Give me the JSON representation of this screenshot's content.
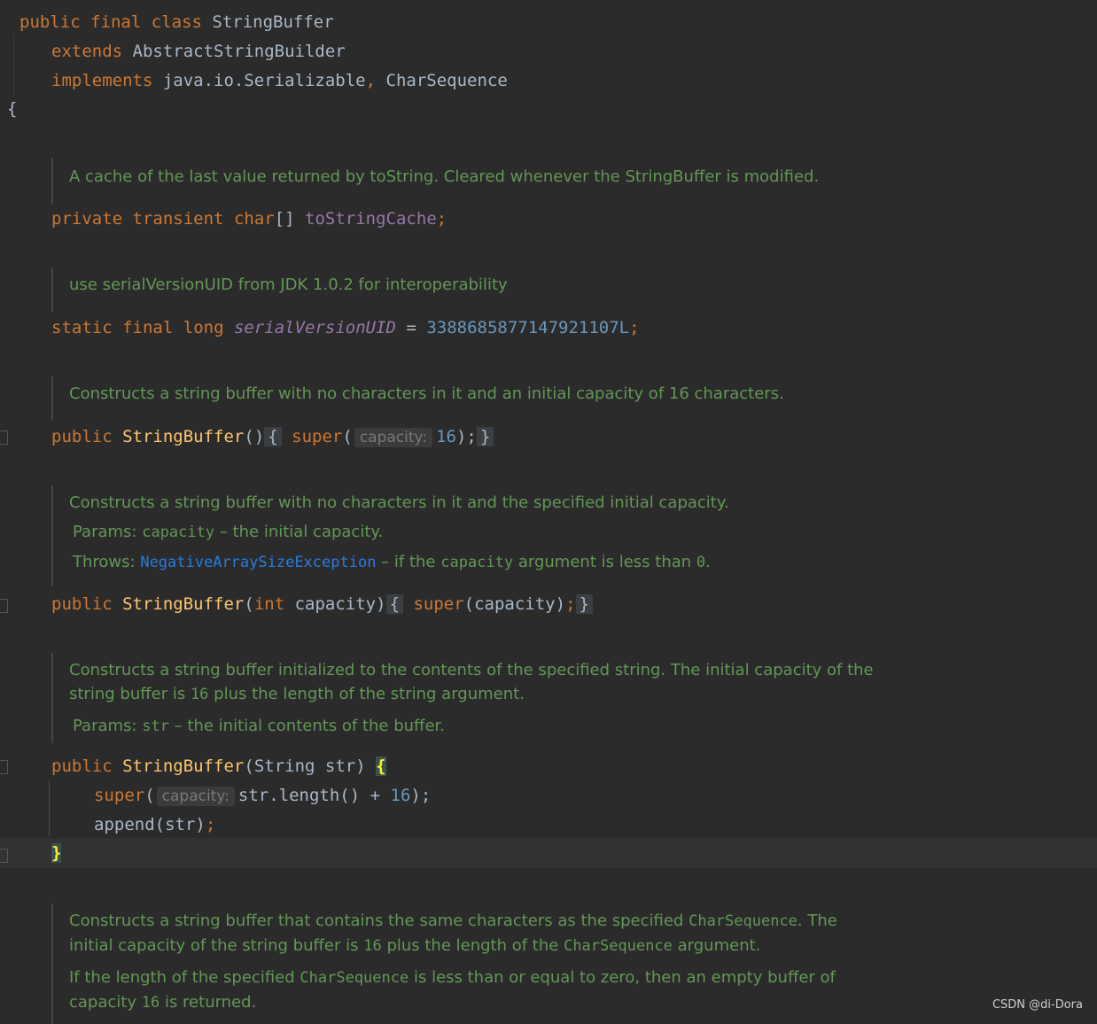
{
  "code": {
    "class_decl": {
      "public": "public",
      "final": "final",
      "class": "class",
      "name": "StringBuffer"
    },
    "extends_line": {
      "kw": "extends",
      "name": "AbstractStringBuilder"
    },
    "implements_line": {
      "kw": "implements",
      "name1": "java.io.Serializable",
      "comma": ",",
      "name2": "CharSequence"
    },
    "open_brace": "{",
    "doc1": "A cache of the last value returned by toString. Cleared whenever the StringBuffer is modified.",
    "field1": {
      "private": "private",
      "transient": "transient",
      "type": "char",
      "brackets": "[]",
      "name": "toStringCache",
      "semi": ";"
    },
    "doc2": "use serialVersionUID from JDK 1.0.2 for interoperability",
    "field2": {
      "static": "static",
      "final": "final",
      "long": "long",
      "name": "serialVersionUID",
      "eq": " = ",
      "value": "3388685877147921107L",
      "semi": ";"
    },
    "doc3": "Constructs a string buffer with no characters in it and an initial capacity of 16 characters.",
    "ctor1": {
      "public": "public",
      "name": "StringBuffer",
      "parens": "()",
      "open": "{",
      "super": "super",
      "paren_open": "(",
      "hint": "capacity:",
      "arg": "16",
      "close_call": ");",
      "close": "}"
    },
    "doc4": {
      "text": "Constructs a string buffer with no characters in it and the specified initial capacity.",
      "params_label": "Params:",
      "params_name": "capacity",
      "params_desc": "– the initial capacity.",
      "throws_label": "Throws:",
      "throws_name": "NegativeArraySizeException",
      "throws_desc1": "– if the",
      "throws_code": "capacity",
      "throws_desc2": "argument is less than",
      "throws_zero": "0",
      "throws_end": "."
    },
    "ctor2": {
      "public": "public",
      "name": "StringBuffer",
      "paren_open": "(",
      "int": "int",
      "param": "capacity)",
      "open": "{",
      "super": "super",
      "call": "(capacity)",
      "semi": ";",
      "close": "}"
    },
    "doc5": {
      "line1": "Constructs a string buffer initialized to the contents of the specified string. The initial capacity of the",
      "line2a": "string buffer is",
      "line2num": "16",
      "line2b": "plus the length of the string argument.",
      "params_label": "Params:",
      "params_name": "str",
      "params_desc": "– the initial contents of the buffer."
    },
    "ctor3": {
      "public": "public",
      "name": "StringBuffer",
      "sig": "(String str)",
      "open": "{",
      "super": "super",
      "paren_open": "(",
      "hint": "capacity:",
      "expr": "str.length() + ",
      "num": "16",
      "end": ");",
      "append": "append(str)",
      "semi": ";",
      "close": "}"
    },
    "doc6": {
      "l1a": "Constructs a string buffer that contains the same characters as the specified",
      "l1code": "CharSequence",
      "l1b": ". The",
      "l2a": "initial capacity of the string buffer is",
      "l2num": "16",
      "l2b": "plus the length of the",
      "l2code": "CharSequence",
      "l2c": "argument.",
      "l3a": "If the length of the specified",
      "l3code": "CharSequence",
      "l3b": "is less than or equal to zero, then an empty buffer of",
      "l4a": "capacity",
      "l4num": "16",
      "l4b": "is returned."
    }
  },
  "watermark": "CSDN @di-Dora"
}
